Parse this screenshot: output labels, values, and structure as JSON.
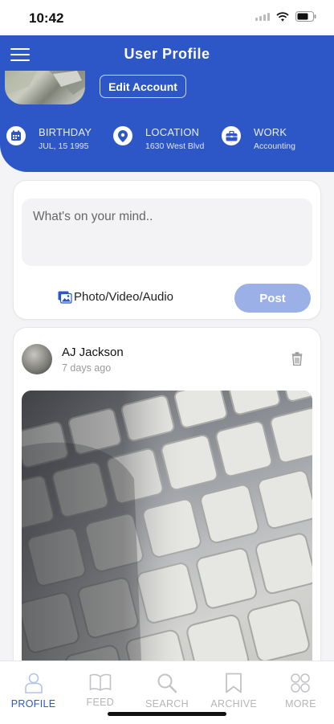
{
  "status": {
    "time": "10:42"
  },
  "header": {
    "title": "User Profile",
    "edit_label": "Edit Account"
  },
  "info": {
    "birthday": {
      "label": "BIRTHDAY",
      "value": "JUL, 15 1995"
    },
    "location": {
      "label": "LOCATION",
      "value": "1630 West Blvd"
    },
    "work": {
      "label": "WORK",
      "value": "Accounting"
    }
  },
  "composer": {
    "placeholder": "What's on your mind..",
    "media_label": "Photo/Video/Audio",
    "post_label": "Post"
  },
  "post": {
    "author": "AJ Jackson",
    "time": "7 days ago"
  },
  "tabs": [
    {
      "label": "PROFILE",
      "icon": "person-icon"
    },
    {
      "label": "FEED",
      "icon": "book-icon"
    },
    {
      "label": "SEARCH",
      "icon": "search-icon"
    },
    {
      "label": "ARCHIVE",
      "icon": "bookmark-icon"
    },
    {
      "label": "MORE",
      "icon": "grid-circles-icon"
    }
  ],
  "colors": {
    "accent": "#2d56c7",
    "post_button": "#9bb0e6",
    "inactive_tab": "#b5b5bb"
  }
}
